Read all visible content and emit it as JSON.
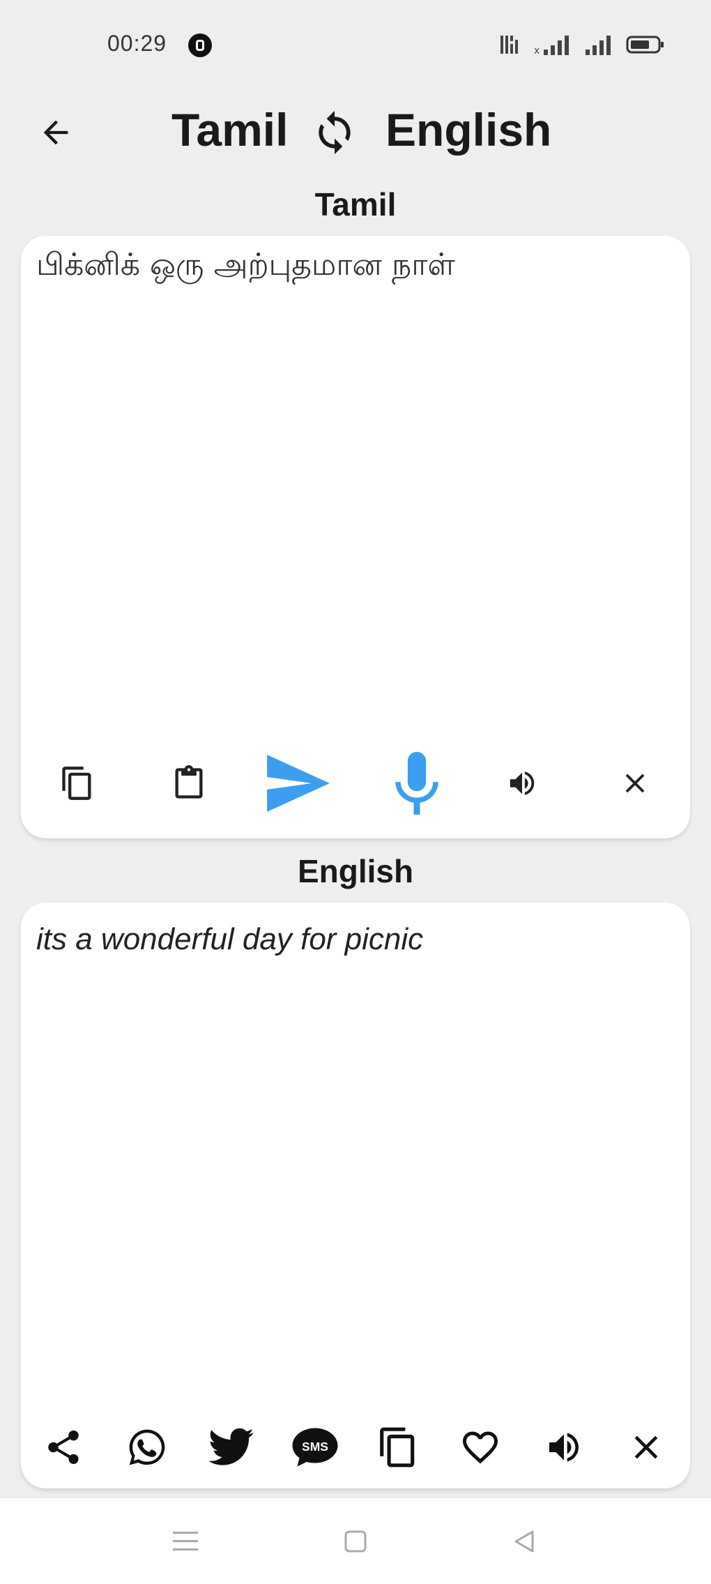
{
  "status_bar": {
    "time": "00:29",
    "icons": [
      "notification-icon",
      "signal-icon",
      "wifi-icon",
      "battery-icon"
    ]
  },
  "header": {
    "source_language": "Tamil",
    "target_language": "English",
    "icons": {
      "back": "arrow-left-icon",
      "swap": "swap-icon"
    }
  },
  "source_panel": {
    "label": "Tamil",
    "text": "பிக்னிக் ஒரு அற்புதமான நாள்",
    "toolbar": [
      "copy-icon",
      "paste-icon",
      "send-icon",
      "mic-icon",
      "speaker-icon",
      "close-icon"
    ]
  },
  "target_panel": {
    "label": "English",
    "text": "its a wonderful day for picnic",
    "toolbar": [
      "share-icon",
      "whatsapp-icon",
      "twitter-icon",
      "sms-icon",
      "copy-icon",
      "heart-icon",
      "speaker-icon",
      "close-icon"
    ]
  },
  "nav_bar": {
    "icons": [
      "menu-icon",
      "home-icon",
      "back-triangle-icon"
    ]
  },
  "colors": {
    "background": "#eeeeee",
    "card": "#ffffff",
    "accent": "#3b9ef0",
    "text": "#1a1a1a"
  }
}
